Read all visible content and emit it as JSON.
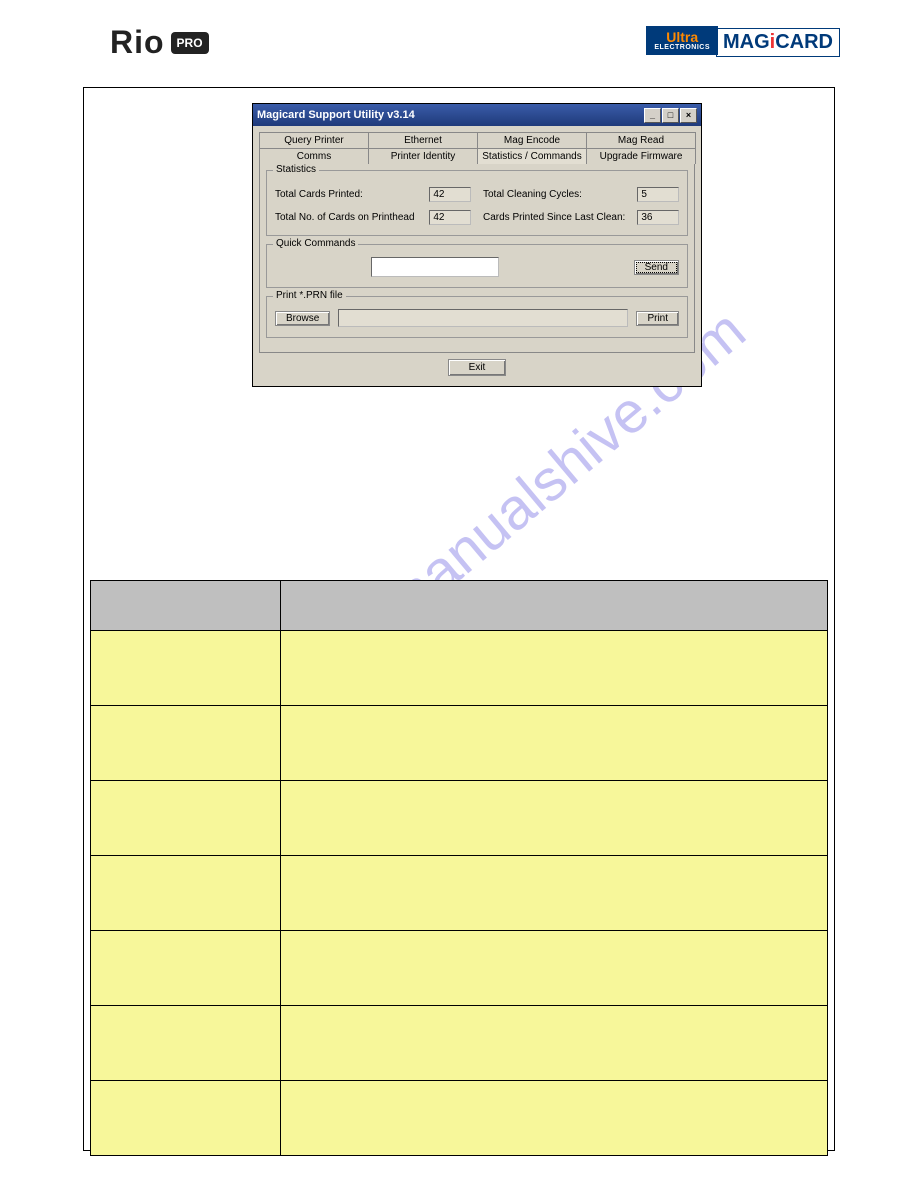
{
  "header": {
    "rio_text": "Rio",
    "rio_badge": "PRO",
    "ultra_top": "Ultra",
    "ultra_bottom": "ELECTRONICS",
    "magicard_prefix": "MAG",
    "magicard_i": "i",
    "magicard_suffix": "CARD"
  },
  "watermark": "manualshive.com",
  "window": {
    "title": "Magicard Support Utility v3.14",
    "controls": {
      "min": "_",
      "max": "□",
      "close": "×"
    },
    "tabs_row1": [
      "Query Printer",
      "Ethernet",
      "Mag Encode",
      "Mag Read"
    ],
    "tabs_row2": [
      "Comms",
      "Printer Identity",
      "Statistics / Commands",
      "Upgrade Firmware"
    ],
    "active_tab": "Statistics / Commands",
    "statistics": {
      "legend": "Statistics",
      "total_cards_label": "Total Cards Printed:",
      "total_cards_value": "42",
      "total_cleaning_label": "Total Cleaning Cycles:",
      "total_cleaning_value": "5",
      "total_ph_label": "Total No. of Cards on Printhead",
      "total_ph_value": "42",
      "since_clean_label": "Cards Printed Since Last Clean:",
      "since_clean_value": "36"
    },
    "quick": {
      "legend": "Quick Commands",
      "input_value": "",
      "send": "Send"
    },
    "prn": {
      "legend": "Print *.PRN file",
      "browse": "Browse",
      "path": "",
      "print": "Print"
    },
    "exit": "Exit"
  },
  "table": {
    "header_col1": "",
    "header_col2": "",
    "rows": [
      {
        "c1": "",
        "c2": ""
      },
      {
        "c1": "",
        "c2": ""
      },
      {
        "c1": "",
        "c2": ""
      },
      {
        "c1": "",
        "c2": ""
      },
      {
        "c1": "",
        "c2": ""
      },
      {
        "c1": "",
        "c2": ""
      },
      {
        "c1": "",
        "c2": ""
      }
    ]
  }
}
